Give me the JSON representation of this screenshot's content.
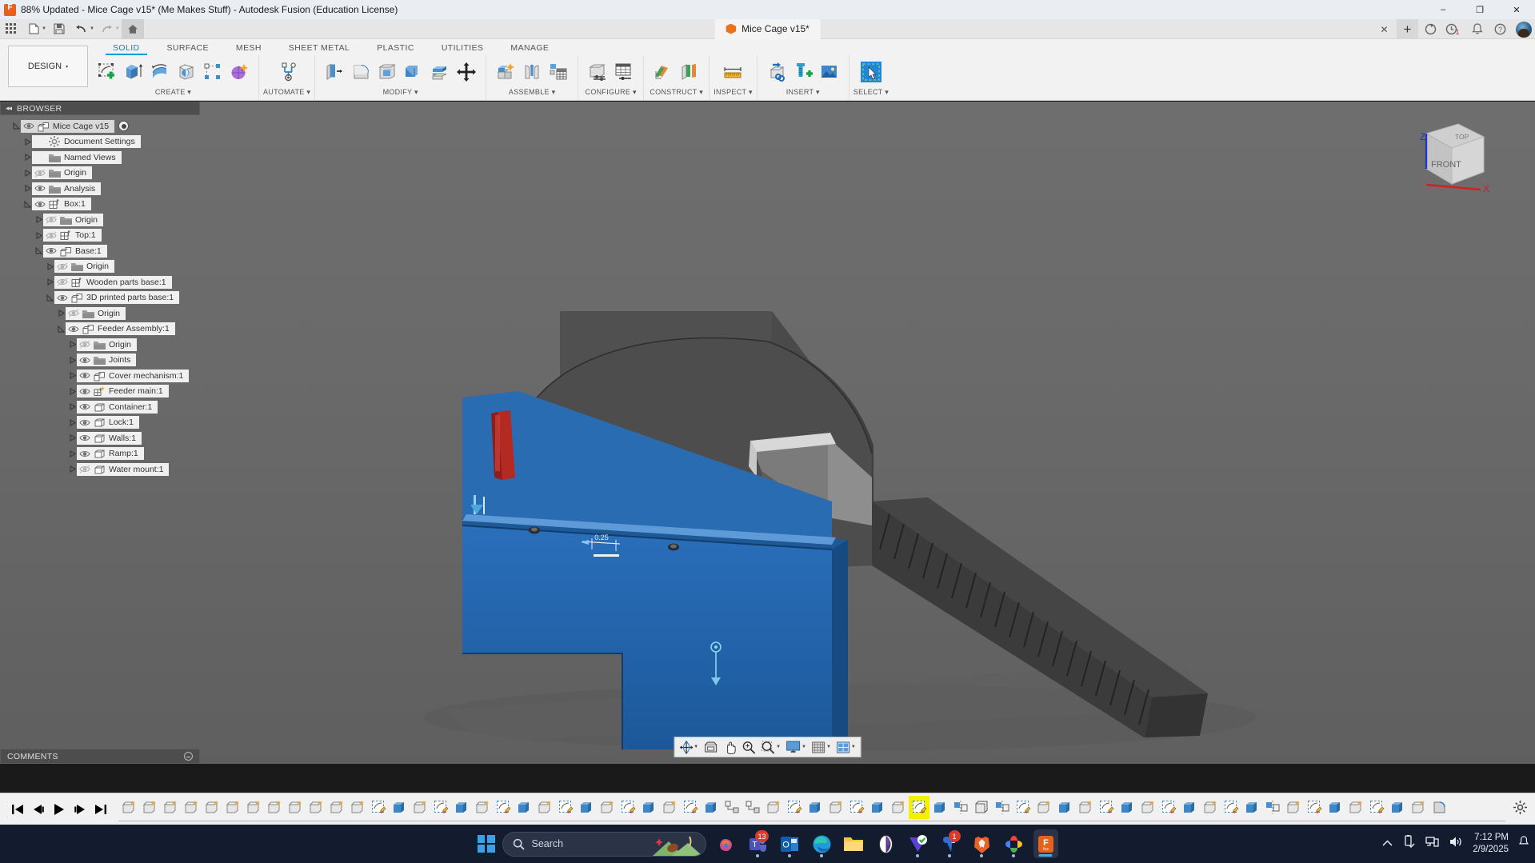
{
  "window": {
    "title": "88% Updated - Mice Cage v15* (Me Makes Stuff) - Autodesk Fusion (Education License)",
    "app_icon": "fusion-logo-icon",
    "minimize": "–",
    "maximize": "❐",
    "close": "✕"
  },
  "quick_access": {
    "buttons": [
      {
        "name": "app-grid-button",
        "glyph": "grid-icon"
      },
      {
        "name": "new-file-button",
        "glyph": "file-icon",
        "caret": true
      },
      {
        "name": "save-button",
        "glyph": "save-icon"
      },
      {
        "name": "undo-button",
        "glyph": "undo-icon",
        "caret": true
      },
      {
        "name": "redo-button",
        "glyph": "redo-icon",
        "caret": true
      },
      {
        "name": "home-button",
        "glyph": "home-icon"
      }
    ],
    "document_tab": {
      "label": "Mice Cage v15*",
      "icon": "orange-cube-icon",
      "close": "✕"
    },
    "right_buttons": [
      {
        "name": "new-tab-button",
        "glyph": "plus-icon",
        "label": "+"
      },
      {
        "name": "refresh-button",
        "glyph": "refresh-icon"
      },
      {
        "name": "job-status-button",
        "glyph": "clock-icon",
        "badge": "1"
      },
      {
        "name": "notifications-button",
        "glyph": "bell-icon"
      },
      {
        "name": "help-button",
        "glyph": "question-icon"
      },
      {
        "name": "account-avatar",
        "glyph": "avatar-icon"
      }
    ]
  },
  "ribbon": {
    "workspace_selector": {
      "label": "DESIGN",
      "caret": "▾"
    },
    "tabs": [
      {
        "label": "SOLID",
        "active": true
      },
      {
        "label": "SURFACE",
        "active": false
      },
      {
        "label": "MESH",
        "active": false
      },
      {
        "label": "SHEET METAL",
        "active": false
      },
      {
        "label": "PLASTIC",
        "active": false
      },
      {
        "label": "UTILITIES",
        "active": false
      },
      {
        "label": "MANAGE",
        "active": false
      }
    ],
    "panels": [
      {
        "label": "CREATE ▾",
        "name": "panel-create",
        "tools": [
          "create-sketch-icon",
          "extrude-icon",
          "revolve-icon",
          "sweep-icon",
          "pattern-icon",
          "form-icon"
        ]
      },
      {
        "label": "AUTOMATE ▾",
        "name": "panel-automate",
        "tools": [
          "automated-modeling-icon"
        ]
      },
      {
        "label": "MODIFY ▾",
        "name": "panel-modify",
        "tools": [
          "press-pull-icon",
          "fillet-icon",
          "shell-icon",
          "combine-icon",
          "offset-face-icon",
          "move-copy-icon"
        ]
      },
      {
        "label": "ASSEMBLE ▾",
        "name": "panel-assemble",
        "tools": [
          "new-component-icon",
          "joint-icon",
          "bom-icon"
        ]
      },
      {
        "label": "CONFIGURE ▾",
        "name": "panel-configure",
        "tools": [
          "configure-design-icon",
          "configure-table-icon"
        ]
      },
      {
        "label": "CONSTRUCT ▾",
        "name": "panel-construct",
        "tools": [
          "offset-plane-icon",
          "plane-at-angle-icon"
        ]
      },
      {
        "label": "INSPECT ▾",
        "name": "panel-inspect",
        "tools": [
          "measure-icon"
        ]
      },
      {
        "label": "INSERT ▾",
        "name": "panel-insert",
        "tools": [
          "insert-derive-icon",
          "insert-mcmaster-icon",
          "insert-image-icon"
        ]
      },
      {
        "label": "SELECT ▾",
        "name": "panel-select",
        "tools": [
          "select-window-icon"
        ]
      }
    ]
  },
  "browser": {
    "header": {
      "title": "BROWSER",
      "collapse": "◂◂"
    },
    "items": [
      {
        "label": "Mice Cage v15",
        "indent": 0,
        "expander": "expanded",
        "eye": "visible",
        "icon": "component-icon",
        "selected": true,
        "radio": true
      },
      {
        "label": "Document Settings",
        "indent": 1,
        "expander": "collapsed",
        "eye": "none",
        "icon": "gear-icon"
      },
      {
        "label": "Named Views",
        "indent": 1,
        "expander": "collapsed",
        "eye": "none",
        "icon": "folder-icon"
      },
      {
        "label": "Origin",
        "indent": 1,
        "expander": "collapsed",
        "eye": "hidden",
        "icon": "folder-icon"
      },
      {
        "label": "Analysis",
        "indent": 1,
        "expander": "collapsed",
        "eye": "visible",
        "icon": "folder-icon"
      },
      {
        "label": "Box:1",
        "indent": 1,
        "expander": "expanded",
        "eye": "visible",
        "icon": "assembly-icon"
      },
      {
        "label": "Origin",
        "indent": 2,
        "expander": "collapsed",
        "eye": "hidden",
        "icon": "folder-icon"
      },
      {
        "label": "Top:1",
        "indent": 2,
        "expander": "collapsed",
        "eye": "hidden",
        "icon": "assembly-icon"
      },
      {
        "label": "Base:1",
        "indent": 2,
        "expander": "expanded",
        "eye": "visible",
        "icon": "component-icon"
      },
      {
        "label": "Origin",
        "indent": 3,
        "expander": "collapsed",
        "eye": "hidden",
        "icon": "folder-icon"
      },
      {
        "label": "Wooden parts base:1",
        "indent": 3,
        "expander": "collapsed",
        "eye": "hidden",
        "icon": "assembly-icon"
      },
      {
        "label": "3D printed parts base:1",
        "indent": 3,
        "expander": "expanded",
        "eye": "visible",
        "icon": "component-icon"
      },
      {
        "label": "Origin",
        "indent": 4,
        "expander": "collapsed",
        "eye": "hidden",
        "icon": "folder-icon"
      },
      {
        "label": "Feeder Assembly:1",
        "indent": 4,
        "expander": "expanded",
        "eye": "visible",
        "icon": "component-icon"
      },
      {
        "label": "Origin",
        "indent": 5,
        "expander": "collapsed",
        "eye": "hidden",
        "icon": "folder-icon"
      },
      {
        "label": "Joints",
        "indent": 5,
        "expander": "collapsed",
        "eye": "visible",
        "icon": "folder-icon"
      },
      {
        "label": "Cover mechanism:1",
        "indent": 5,
        "expander": "collapsed",
        "eye": "visible",
        "icon": "component-icon"
      },
      {
        "label": "Feeder main:1",
        "indent": 5,
        "expander": "collapsed",
        "eye": "visible",
        "icon": "assembly-star-icon"
      },
      {
        "label": "Container:1",
        "indent": 5,
        "expander": "collapsed",
        "eye": "visible",
        "icon": "body-icon"
      },
      {
        "label": "Lock:1",
        "indent": 5,
        "expander": "collapsed",
        "eye": "visible",
        "icon": "body-icon"
      },
      {
        "label": "Walls:1",
        "indent": 5,
        "expander": "collapsed",
        "eye": "visible",
        "icon": "body-icon"
      },
      {
        "label": "Ramp:1",
        "indent": 5,
        "expander": "collapsed",
        "eye": "visible",
        "icon": "body-icon"
      },
      {
        "label": "Water mount:1",
        "indent": 5,
        "expander": "collapsed",
        "eye": "hidden",
        "icon": "body-icon"
      }
    ]
  },
  "comments": {
    "label": "COMMENTS"
  },
  "viewcube": {
    "top_face": "TOP",
    "front_face": "FRONT",
    "axis_x": "X",
    "axis_z": "Z",
    "color_x": "#d42020",
    "color_z": "#2036d4"
  },
  "canvas": {
    "dimension_label": "0.25",
    "body_blue": "#1f62ae",
    "body_dark": "#3b3b3b",
    "background": "#6a6a6a",
    "accent_red": "#d4342a"
  },
  "nav_toolbar": {
    "buttons": [
      {
        "name": "orbit-button",
        "glyph": "orbit-icon",
        "caret": true
      },
      {
        "name": "look-at-button",
        "glyph": "look-at-icon",
        "caret": false
      },
      {
        "name": "pan-button",
        "glyph": "hand-icon",
        "caret": false
      },
      {
        "name": "zoom-button",
        "glyph": "zoom-icon",
        "caret": false
      },
      {
        "name": "fit-button",
        "glyph": "fit-icon",
        "caret": true
      },
      {
        "name": "display-settings-button",
        "glyph": "monitor-icon",
        "caret": true
      },
      {
        "name": "grid-snaps-button",
        "glyph": "grid-icon",
        "caret": true
      },
      {
        "name": "viewports-button",
        "glyph": "viewports-icon",
        "caret": true
      }
    ]
  },
  "timeline": {
    "playback": [
      {
        "name": "go-to-beginning-button",
        "glyph": "skip-start-icon"
      },
      {
        "name": "step-back-button",
        "glyph": "step-back-icon"
      },
      {
        "name": "play-button",
        "glyph": "play-icon"
      },
      {
        "name": "step-forward-button",
        "glyph": "step-forward-icon"
      },
      {
        "name": "go-to-end-button",
        "glyph": "skip-end-icon"
      }
    ],
    "features": [
      {
        "type": "component",
        "hl": false
      },
      {
        "type": "component",
        "hl": false
      },
      {
        "type": "component",
        "hl": false
      },
      {
        "type": "component",
        "hl": false
      },
      {
        "type": "component",
        "hl": false
      },
      {
        "type": "component",
        "hl": false
      },
      {
        "type": "component",
        "hl": false
      },
      {
        "type": "component",
        "hl": false
      },
      {
        "type": "component",
        "hl": false
      },
      {
        "type": "component",
        "hl": false
      },
      {
        "type": "component",
        "hl": false
      },
      {
        "type": "component",
        "hl": false
      },
      {
        "type": "sketch",
        "hl": false
      },
      {
        "type": "extrude",
        "hl": false
      },
      {
        "type": "component",
        "hl": false
      },
      {
        "type": "sketch",
        "hl": false
      },
      {
        "type": "extrude",
        "hl": false
      },
      {
        "type": "component",
        "hl": false
      },
      {
        "type": "sketch",
        "hl": false
      },
      {
        "type": "extrude",
        "hl": false
      },
      {
        "type": "component",
        "hl": false
      },
      {
        "type": "sketch",
        "hl": false
      },
      {
        "type": "extrude",
        "hl": false
      },
      {
        "type": "component",
        "hl": false
      },
      {
        "type": "sketch",
        "hl": false
      },
      {
        "type": "extrude",
        "hl": false
      },
      {
        "type": "component",
        "hl": false
      },
      {
        "type": "sketch",
        "hl": false
      },
      {
        "type": "extrude",
        "hl": false
      },
      {
        "type": "joint",
        "hl": false
      },
      {
        "type": "joint",
        "hl": false
      },
      {
        "type": "component",
        "hl": false
      },
      {
        "type": "sketch",
        "hl": false
      },
      {
        "type": "extrude",
        "hl": false
      },
      {
        "type": "component",
        "hl": false
      },
      {
        "type": "sketch",
        "hl": false
      },
      {
        "type": "extrude",
        "hl": false
      },
      {
        "type": "component",
        "hl": false
      },
      {
        "type": "sketch",
        "hl": true
      },
      {
        "type": "extrude",
        "hl": false
      },
      {
        "type": "mirror",
        "hl": false
      },
      {
        "type": "shell",
        "hl": false
      },
      {
        "type": "mirror",
        "hl": false
      },
      {
        "type": "sketch",
        "hl": false
      },
      {
        "type": "component",
        "hl": false
      },
      {
        "type": "extrude",
        "hl": false
      },
      {
        "type": "component",
        "hl": false
      },
      {
        "type": "sketch",
        "hl": false
      },
      {
        "type": "extrude",
        "hl": false
      },
      {
        "type": "component",
        "hl": false
      },
      {
        "type": "sketch",
        "hl": false
      },
      {
        "type": "extrude",
        "hl": false
      },
      {
        "type": "component",
        "hl": false
      },
      {
        "type": "sketch",
        "hl": false
      },
      {
        "type": "extrude",
        "hl": false
      },
      {
        "type": "mirror",
        "hl": false
      },
      {
        "type": "component",
        "hl": false
      },
      {
        "type": "sketch",
        "hl": false
      },
      {
        "type": "extrude",
        "hl": false
      },
      {
        "type": "component",
        "hl": false
      },
      {
        "type": "sketch",
        "hl": false
      },
      {
        "type": "extrude",
        "hl": false
      },
      {
        "type": "component",
        "hl": false
      },
      {
        "type": "fillet",
        "hl": false
      }
    ],
    "settings": {
      "name": "timeline-settings-button",
      "glyph": "gear-icon"
    }
  },
  "taskbar": {
    "start": {
      "name": "start-button",
      "glyph": "windows-logo-icon"
    },
    "search": {
      "placeholder": "Search",
      "icon": "search-icon"
    },
    "apps": [
      {
        "name": "copilot-icon",
        "running": false,
        "badge": null
      },
      {
        "name": "teams-icon",
        "running": true,
        "badge": "13"
      },
      {
        "name": "outlook-icon",
        "running": true,
        "badge": null
      },
      {
        "name": "edge-icon",
        "running": true,
        "badge": null
      },
      {
        "name": "file-explorer-icon",
        "running": false,
        "badge": null
      },
      {
        "name": "onenote-icon",
        "running": false,
        "badge": null
      },
      {
        "name": "vectorworks-icon",
        "running": true,
        "badge": null
      },
      {
        "name": "wunderlist-icon",
        "running": true,
        "badge": "1"
      },
      {
        "name": "brave-icon",
        "running": true,
        "badge": null
      },
      {
        "name": "google-photos-icon",
        "running": true,
        "badge": null
      },
      {
        "name": "fusion-icon",
        "running": true,
        "active": true,
        "badge": null
      }
    ],
    "tray": {
      "chevron": "show-hidden-icons",
      "usb": "usb-safely-remove-icon",
      "network": "network-icon",
      "volume": "volume-icon",
      "time": "7:12 PM",
      "date": "2/9/2025"
    }
  }
}
